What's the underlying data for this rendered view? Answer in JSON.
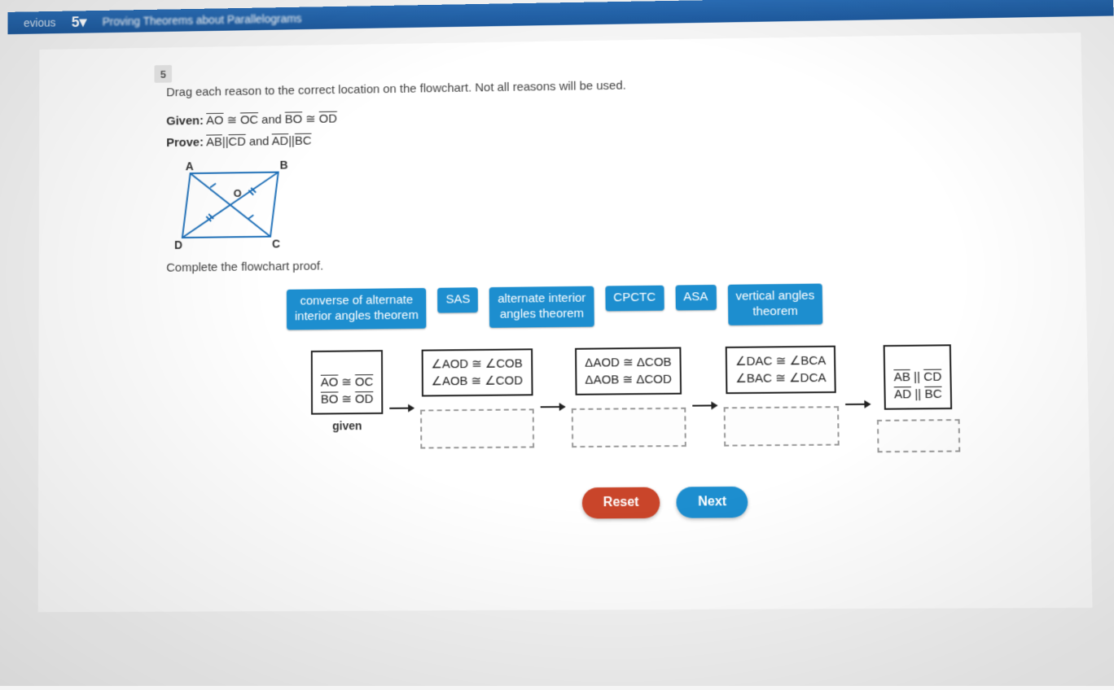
{
  "topbar": {
    "previous": "evious",
    "step": "5",
    "dropdown_icon": "▾",
    "title": "Proving Theorems about Parallelograms"
  },
  "question": {
    "number": "5",
    "instructions": "Drag each reason to the correct location on the flowchart. Not all reasons will be used.",
    "given_label": "Given:",
    "given_text_html": "AO ≅ OC and BO ≅ OD",
    "prove_label": "Prove:",
    "prove_text_html": "AB || CD and AD || BC",
    "diagram_labels": {
      "A": "A",
      "B": "B",
      "C": "C",
      "D": "D",
      "O": "O"
    },
    "complete": "Complete the flowchart proof."
  },
  "reasons": [
    "converse of alternate\ninterior angles theorem",
    "SAS",
    "alternate interior\nangles theorem",
    "CPCTC",
    "ASA",
    "vertical angles\ntheorem"
  ],
  "flow": {
    "c0": {
      "box": "AO ≅ OC\nBO ≅ OD",
      "label": "given"
    },
    "c1": {
      "box": "∠AOD ≅ ∠COB\n∠AOB ≅ ∠COD"
    },
    "c2": {
      "box": "ΔAOD ≅ ΔCOB\nΔAOB ≅ ΔCOD"
    },
    "c3": {
      "box": "∠DAC ≅ ∠BCA\n∠BAC ≅ ∠DCA"
    },
    "c4": {
      "box": "AB || CD\nAD || BC"
    }
  },
  "buttons": {
    "reset": "Reset",
    "next": "Next"
  }
}
